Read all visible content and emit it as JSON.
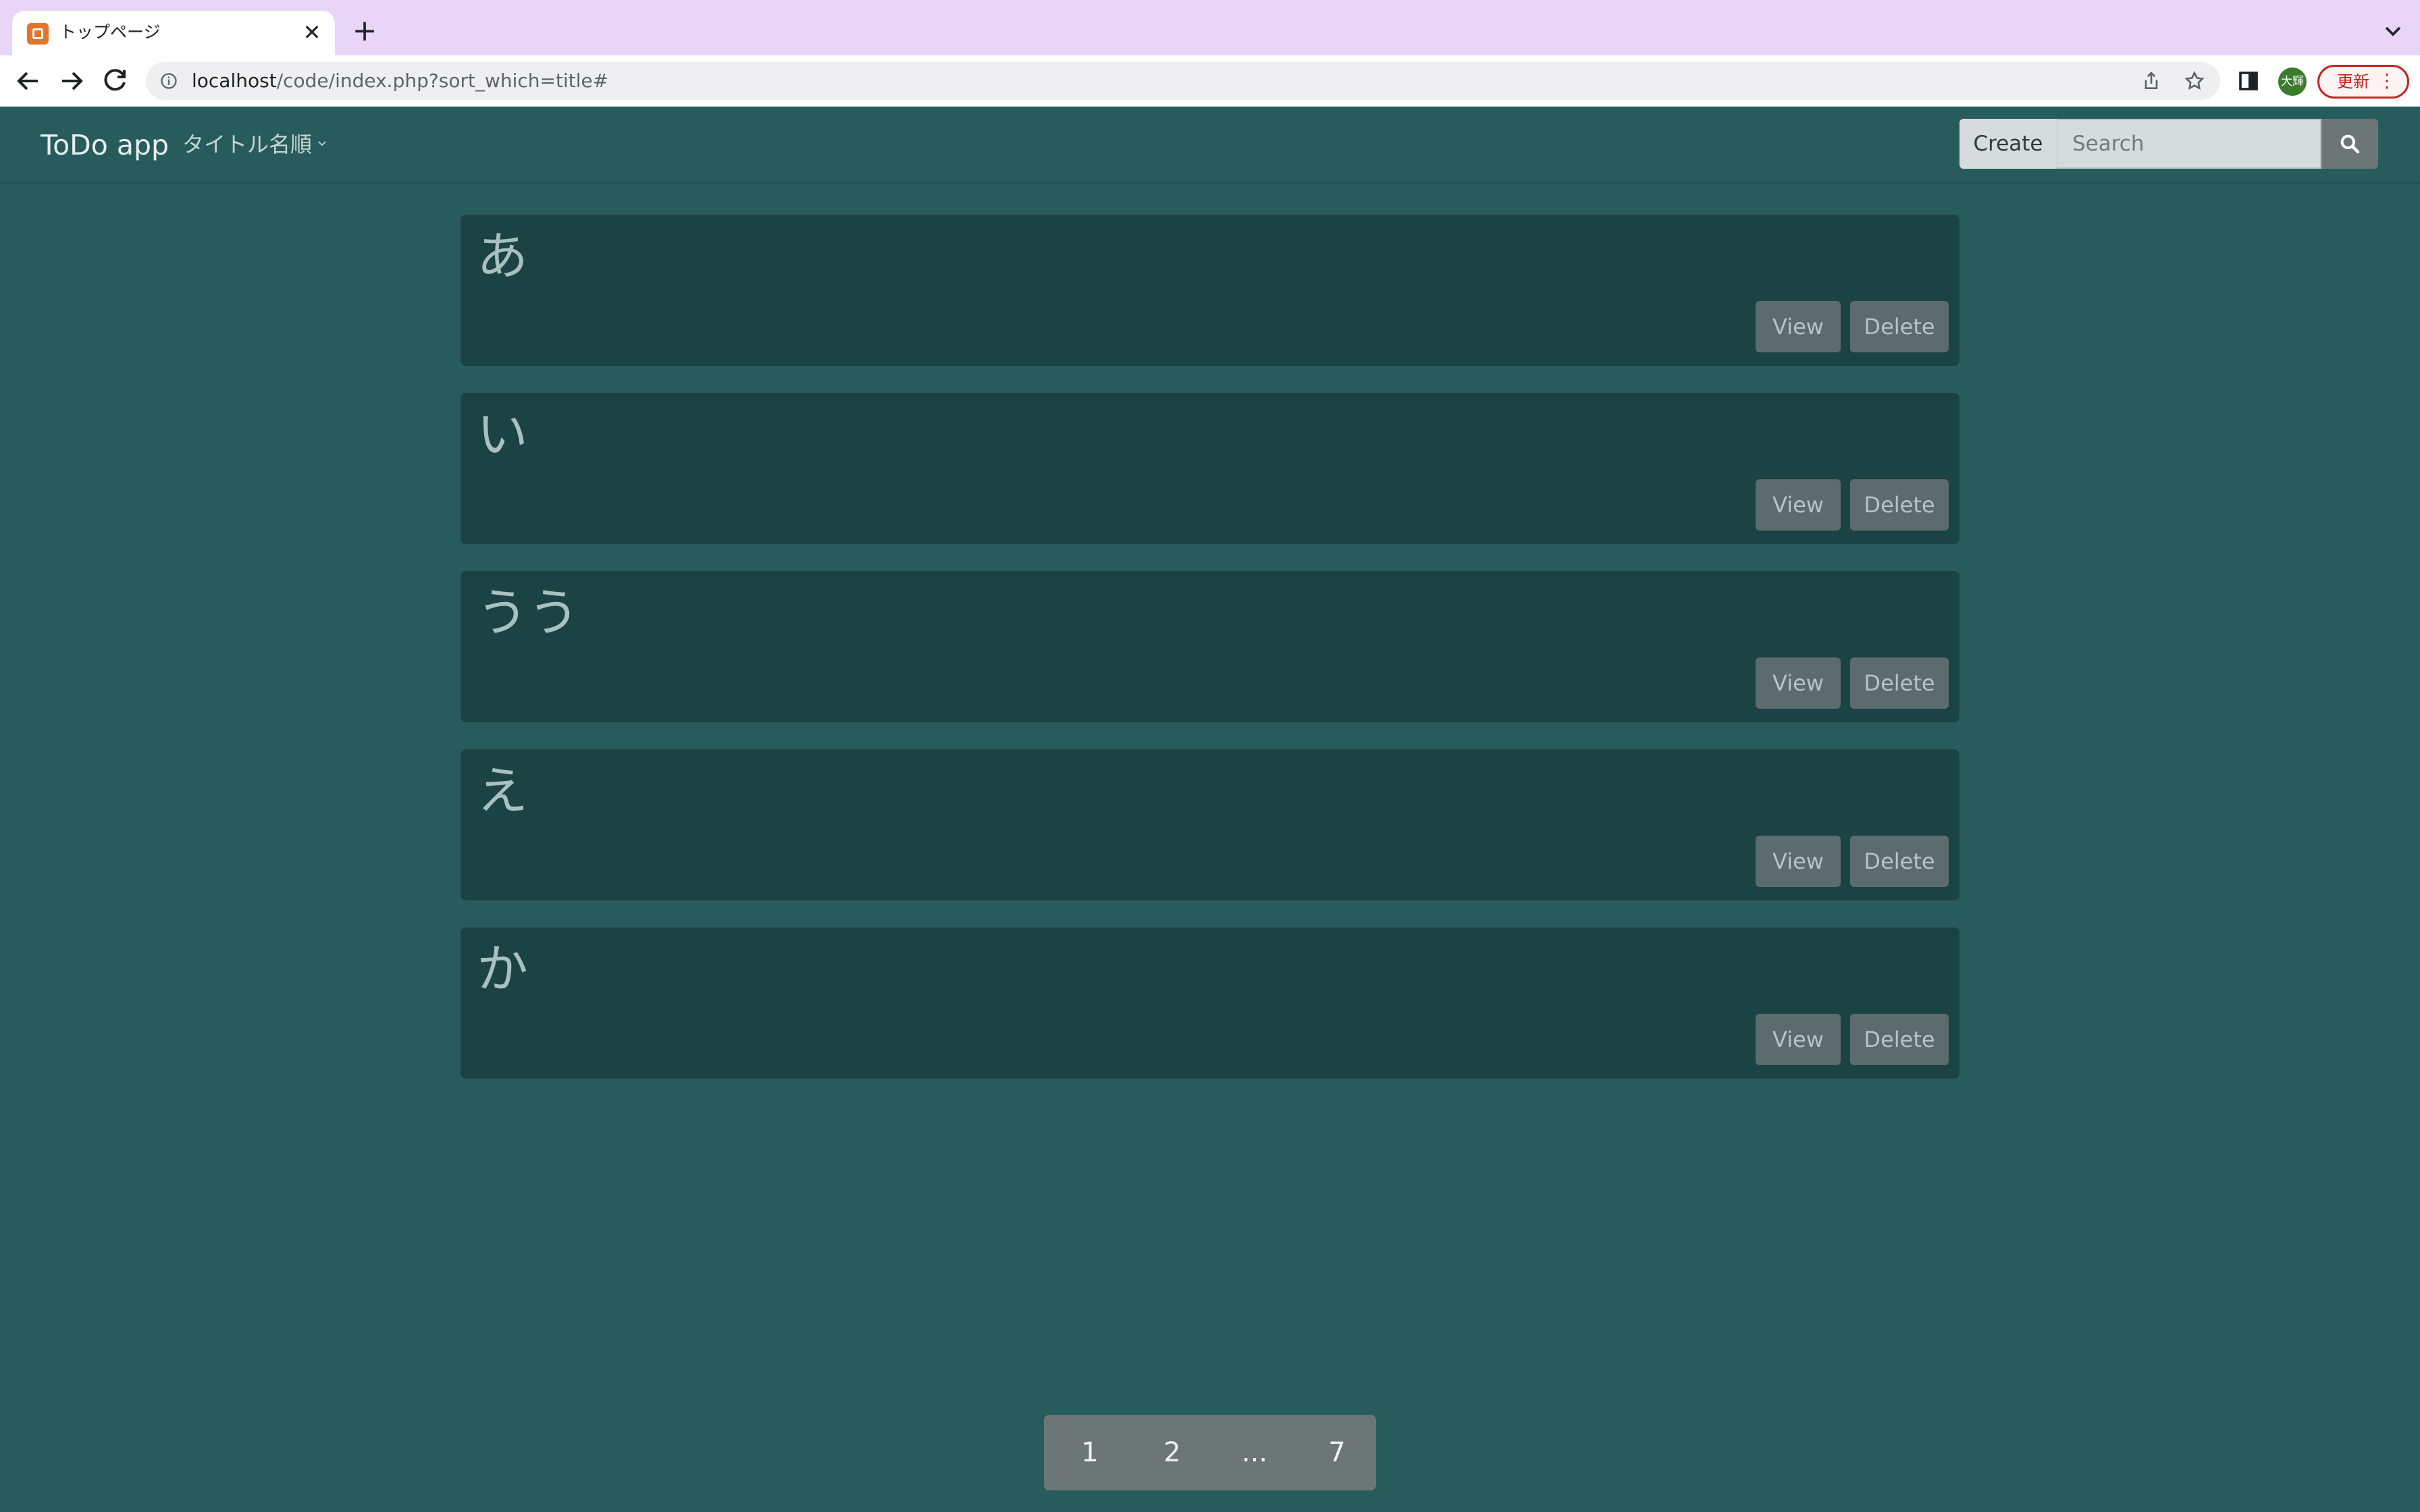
{
  "browser": {
    "tab_title": "トップページ",
    "tab_close": "✕",
    "new_tab": "+",
    "url_host": "localhost",
    "url_path": "/code/index.php?sort_which=title#",
    "profile_initials": "大輝",
    "update_label": "更新",
    "update_menu": "⋮"
  },
  "navbar": {
    "brand": "ToDo app",
    "sort_label": "タイトル名順",
    "create_label": "Create",
    "search_placeholder": "Search"
  },
  "todos": [
    {
      "title": "あ",
      "view_label": "View",
      "delete_label": "Delete"
    },
    {
      "title": "い",
      "view_label": "View",
      "delete_label": "Delete"
    },
    {
      "title": "うう",
      "view_label": "View",
      "delete_label": "Delete"
    },
    {
      "title": "え",
      "view_label": "View",
      "delete_label": "Delete"
    },
    {
      "title": "か",
      "view_label": "View",
      "delete_label": "Delete"
    }
  ],
  "pagination": [
    "1",
    "2",
    "...",
    "7"
  ],
  "colors": {
    "page_background": "#285b5b",
    "card_background": "#1c4343",
    "button_background": "#5c6b6d",
    "tab_bar": "#e8d5f7",
    "update_accent": "#c5221f"
  }
}
